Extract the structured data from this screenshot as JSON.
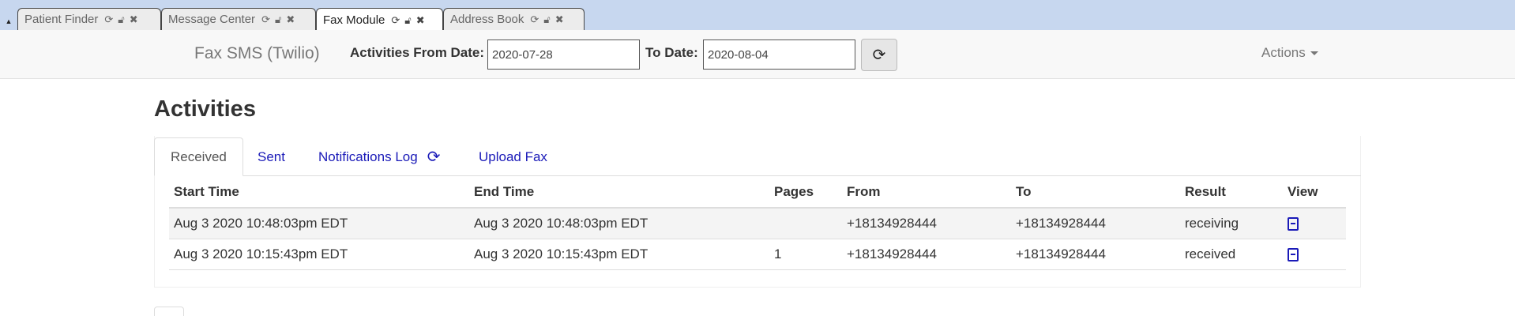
{
  "tabbar": {
    "collapse_icon": "triangle-up-icon",
    "tabs": [
      {
        "label": "Patient Finder",
        "active": false
      },
      {
        "label": "Message Center",
        "active": false
      },
      {
        "label": "Fax Module",
        "active": true
      },
      {
        "label": "Address Book",
        "active": false
      }
    ]
  },
  "toolbar": {
    "brand": "Fax SMS (Twilio)",
    "from_label": "Activities From Date:",
    "from_value": "2020-07-28",
    "to_label": "To Date:",
    "to_value": "2020-08-04",
    "refresh_icon": "refresh-icon",
    "actions_label": "Actions"
  },
  "main": {
    "title": "Activities",
    "nav_tabs": [
      {
        "label": "Received",
        "active": true
      },
      {
        "label": "Sent",
        "active": false
      },
      {
        "label": "Notifications Log",
        "active": false,
        "icon": "refresh-icon"
      },
      {
        "label": "Upload Fax",
        "active": false
      }
    ],
    "table": {
      "headers": [
        "Start Time",
        "End Time",
        "Pages",
        "From",
        "To",
        "Result",
        "View"
      ],
      "rows": [
        {
          "start": "Aug 3 2020 10:48:03pm EDT",
          "end": "Aug 3 2020 10:48:03pm EDT",
          "pages": "",
          "from": "+18134928444",
          "to": "+18134928444",
          "result": "receiving",
          "view_icon": "pdf-file-icon"
        },
        {
          "start": "Aug 3 2020 10:15:43pm EDT",
          "end": "Aug 3 2020 10:15:43pm EDT",
          "pages": "1",
          "from": "+18134928444",
          "to": "+18134928444",
          "result": "received",
          "view_icon": "pdf-file-icon"
        }
      ]
    }
  },
  "colors": {
    "tabbar_bg": "#c7d7ef",
    "link": "#1a1ab8",
    "toolbar_bg": "#f8f8f8"
  }
}
